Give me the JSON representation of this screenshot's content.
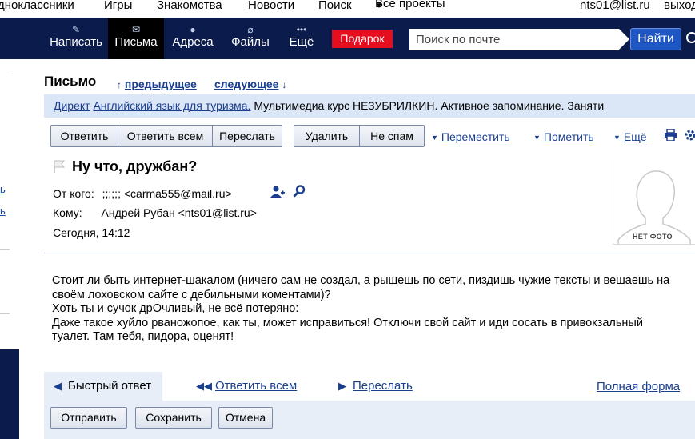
{
  "portal": {
    "items": [
      "дноклассники",
      "Игры",
      "Знакомства",
      "Новости",
      "Поиск",
      "Все проекты"
    ],
    "user_email": "nts01@list.ru",
    "logout": "выход"
  },
  "nav": {
    "items": [
      {
        "label": "Написать",
        "icon": "pencil-icon"
      },
      {
        "label": "Письма",
        "icon": "envelope-icon"
      },
      {
        "label": "Адреса",
        "icon": "person-icon"
      },
      {
        "label": "Файлы",
        "icon": "paperclip-icon"
      },
      {
        "label": "Ещё",
        "icon": "dots-icon"
      }
    ],
    "gift": "Подарок",
    "search_placeholder": "Поиск по почте",
    "find": "Найти"
  },
  "left": {
    "link1": "ь",
    "link2": "ь"
  },
  "message": {
    "page_title": "Письмо",
    "prev": "предыдущее",
    "next": "следующее",
    "ad": {
      "direct": "Директ",
      "link": "Английский язык для туризма.",
      "text": "Мультимедиа курс НЕЗУБРИЛКИН. Активное запоминание. Заняти"
    },
    "toolbar": {
      "group1": [
        "Ответить",
        "Ответить всем",
        "Переслать"
      ],
      "group2": [
        "Удалить",
        "Не спам"
      ],
      "move": "Переместить",
      "mark": "Пометить",
      "more": "Ещё"
    },
    "subject": "Ну что, дружбан?",
    "from_label": "От кого:",
    "from_value": ";;;;;; <carma555@mail.ru>",
    "to_label": "Кому:",
    "to_value": "Андрей Рубан <nts01@list.ru>",
    "date": "Сегодня, 14:12",
    "no_photo": "НЕТ ФОТО",
    "body": [
      "Стоит ли быть интернет-шакалом (ничего сам не создал, а рыщешь по сети, пиздишь чужие тексты и вешаешь на своём лоховском сайте с дебильными коментами)?",
      "Хоть ты и сучок дрОчливый, не всё потеряно:",
      "Даже такое хуйло рваножопое, как ты, может исправиться! Отключи свой сайт и иди сосать в привокзальный туалет. Там тебя, пидора, оценят!"
    ]
  },
  "quick_reply": {
    "tabs": [
      "Быстрый ответ",
      "Ответить всем",
      "Переслать"
    ],
    "full_form": "Полная форма",
    "buttons": [
      "Отправить",
      "Сохранить",
      "Отмена"
    ]
  }
}
